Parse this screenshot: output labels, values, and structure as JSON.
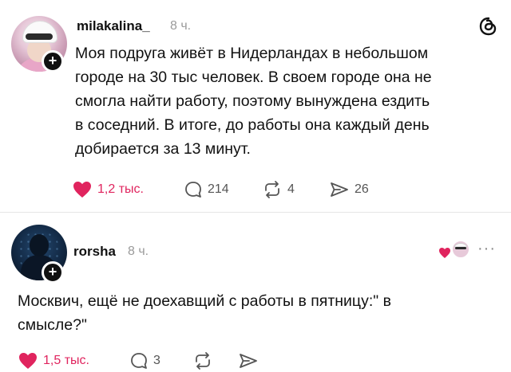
{
  "posts": [
    {
      "username": "milakalina_",
      "time": "8 ч.",
      "text_lines": [
        "Моя подруга живёт в Нидерландах в небольшом",
        "городе на 30 тыс человек. В своем городе она не",
        "смогла найти работу, поэтому вынуждена ездить",
        "в соседний. В итоге, до работы она каждый день",
        "добирается за 13 минут."
      ],
      "actions": {
        "likes": "1,2 тыс.",
        "replies": "214",
        "reposts": "4",
        "shares": "26"
      }
    },
    {
      "username": "rorsha",
      "time": "8 ч.",
      "text_lines": [
        "Москвич, ещё не доехавщий с работы в пятницу:\" в",
        "смысле?\""
      ],
      "actions": {
        "likes": "1,5 тыс.",
        "replies": "3"
      }
    }
  ],
  "icons": [
    "threads-icon",
    "heart-icon",
    "reply-icon",
    "repost-icon",
    "share-icon",
    "more-icon"
  ],
  "colors": {
    "like": "#e0245e",
    "muted": "#9a9a9a"
  }
}
